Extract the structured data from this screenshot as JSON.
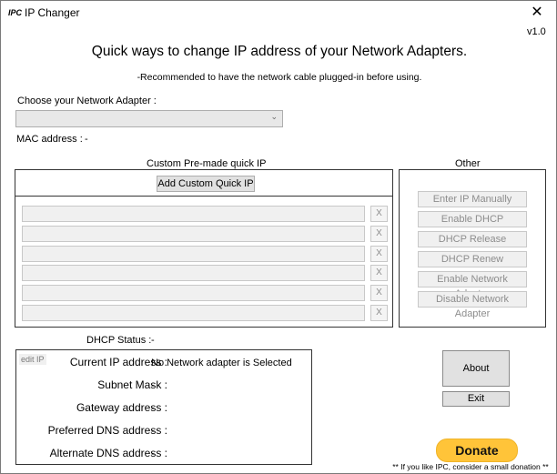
{
  "window": {
    "logo": "IPC",
    "title": "IP Changer",
    "close_icon": "✕",
    "version": "v1.0"
  },
  "header": {
    "heading": "Quick ways to change IP address of your Network Adapters.",
    "subheading": "-Recommended to have the network cable plugged-in before using."
  },
  "adapter": {
    "label": "Choose your Network Adapter :",
    "selected": "",
    "chevron_icon": "⌄",
    "mac_label": "MAC address :",
    "mac_value": "-"
  },
  "quick_ip": {
    "title": "Custom Pre-made quick IP",
    "add_button": "Add Custom Quick IP",
    "slots": [
      {
        "value": "",
        "remove": "X"
      },
      {
        "value": "",
        "remove": "X"
      },
      {
        "value": "",
        "remove": "X"
      },
      {
        "value": "",
        "remove": "X"
      },
      {
        "value": "",
        "remove": "X"
      },
      {
        "value": "",
        "remove": "X"
      }
    ]
  },
  "other": {
    "title": "Other",
    "buttons": [
      "Enter IP Manually",
      "Enable DHCP",
      "DHCP Release",
      "DHCP Renew",
      "Enable Network Adapter",
      "Disable Network Adapter"
    ]
  },
  "status": {
    "dhcp_label": "DHCP Status :",
    "dhcp_value": "-",
    "edit_ip": "edit IP",
    "rows": [
      {
        "label": "Current IP address :",
        "value": "No Network adapter is Selected"
      },
      {
        "label": "Subnet Mask :",
        "value": "-"
      },
      {
        "label": "Gateway address :",
        "value": "-"
      },
      {
        "label": "Preferred DNS address :",
        "value": "-"
      },
      {
        "label": "Alternate DNS address :",
        "value": "-"
      }
    ]
  },
  "actions": {
    "about": "About",
    "exit": "Exit",
    "donate": "Donate",
    "donate_note": "** If you like IPC, consider a small donation **"
  },
  "colors": {
    "donate_bg": "#ffc439",
    "button_bg": "#e1e1e1",
    "disabled_text": "#8d8d8d"
  }
}
